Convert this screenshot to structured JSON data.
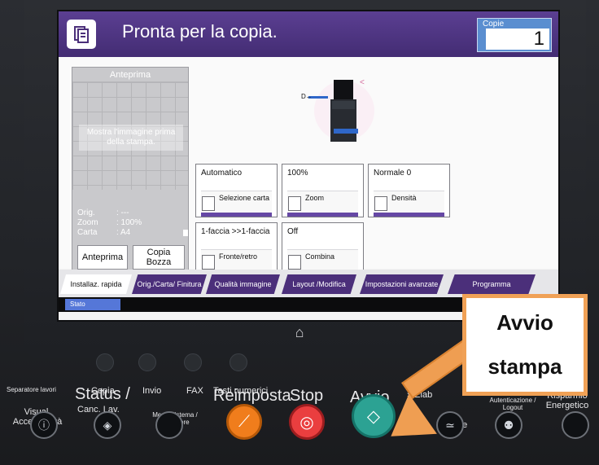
{
  "screen": {
    "title": "Pronta per la copia.",
    "copies": {
      "label": "Copie",
      "value": "1"
    },
    "preview": {
      "heading": "Anteprima",
      "message": "Mostra l'immagine prima della stampa.",
      "rows": [
        {
          "label": "Orig.",
          "value": ": ---"
        },
        {
          "label": "Zoom",
          "value": ": 100%"
        },
        {
          "label": "Carta",
          "value": ": A4"
        }
      ],
      "preview_button": "Anteprima",
      "draft_button": "Copia Bozza"
    },
    "tiles": [
      {
        "value": "Automatico",
        "label": "Selezione carta",
        "icon": "paper-tray-icon"
      },
      {
        "value": "100%",
        "label": "Zoom",
        "icon": "zoom-icon"
      },
      {
        "value": "Normale 0",
        "label": "Densità",
        "icon": "density-icon"
      },
      {
        "value": "1-faccia >>1-faccia",
        "label": "Fronte/retro",
        "icon": "duplex-icon"
      },
      {
        "value": "Off",
        "label": "Combina",
        "icon": "combine-icon"
      }
    ],
    "tabs": [
      {
        "label": "Installaz. rapida",
        "active": true
      },
      {
        "label": "Orig./Carta/ Finitura",
        "active": false
      },
      {
        "label": "Qualità immagine",
        "active": false
      },
      {
        "label": "Layout /Modifica",
        "active": false
      },
      {
        "label": "Impostazioni avanzate",
        "active": false
      },
      {
        "label": "Programma",
        "active": false
      }
    ],
    "status": "Stato"
  },
  "panel": {
    "separatore": "Separatore lavori",
    "copia": "Copia",
    "invio": "Invio",
    "fax": "FAX",
    "tasti": "Tasti numerici",
    "visual": "Visual. Accessibilità",
    "status": "Status /",
    "canc": "Canc. Lav.",
    "menu": "Menu Sistema / Contatore",
    "reimposta": "Reimposta",
    "stop": "Stop",
    "avvio": "Avvio",
    "elab": "» Elab",
    "interruzione": "zione",
    "auth": "Autenticazione / Logout",
    "risparmio": "Risparmio Energetico"
  },
  "callout": {
    "line1": "Avvio",
    "line2": "stampa"
  },
  "colors": {
    "purple": "#4b2f7a",
    "copy_box": "#5a8ed0",
    "start": "#2ca293",
    "stop": "#ea3e3f",
    "reset": "#f07d1c",
    "callout_border": "#f0a156"
  }
}
